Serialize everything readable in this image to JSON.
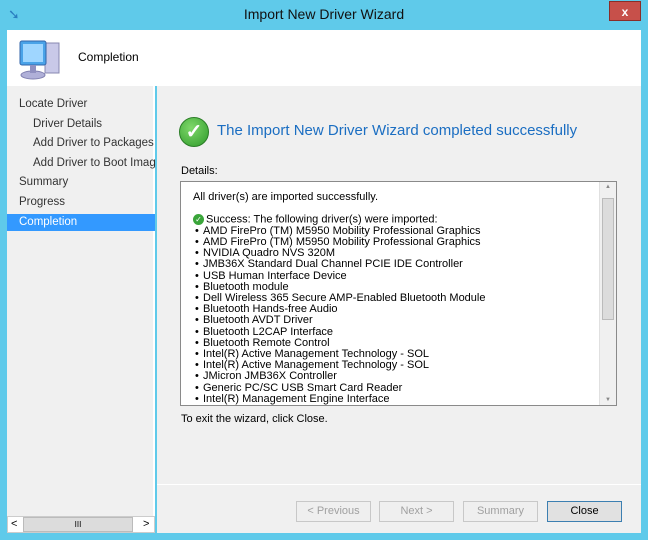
{
  "window": {
    "title": "Import New Driver Wizard",
    "close": "x"
  },
  "header": {
    "title": "Completion"
  },
  "nav": {
    "items": [
      {
        "label": "Locate Driver",
        "sub": false,
        "selected": false
      },
      {
        "label": "Driver Details",
        "sub": true,
        "selected": false
      },
      {
        "label": "Add Driver to Packages",
        "sub": true,
        "selected": false
      },
      {
        "label": "Add Driver to Boot Images",
        "sub": true,
        "selected": false
      },
      {
        "label": "Summary",
        "sub": false,
        "selected": false
      },
      {
        "label": "Progress",
        "sub": false,
        "selected": false
      },
      {
        "label": "Completion",
        "sub": false,
        "selected": true
      }
    ],
    "scroll_left": "<",
    "scroll_thumb": "III",
    "scroll_right": ">"
  },
  "main": {
    "title": "The Import New Driver Wizard completed successfully",
    "details_label": "Details:",
    "summary_line": "All driver(s) are imported successfully.",
    "success_line": "Success: The following driver(s) were imported:",
    "drivers": [
      "AMD FirePro (TM) M5950 Mobility Professional Graphics",
      "AMD FirePro (TM) M5950 Mobility Professional Graphics",
      "NVIDIA Quadro NVS 320M",
      "JMB36X Standard Dual Channel PCIE IDE Controller",
      "USB Human Interface Device",
      "Bluetooth module",
      "Dell Wireless 365 Secure AMP-Enabled Bluetooth Module",
      "Bluetooth Hands-free Audio",
      "Bluetooth AVDT Driver",
      "Bluetooth L2CAP Interface",
      "Bluetooth Remote Control",
      "Intel(R) Active Management Technology - SOL",
      "Intel(R) Active Management Technology - SOL",
      "JMicron JMB36X Controller",
      "Generic PC/SC USB Smart Card Reader",
      "Intel(R) Management Engine Interface"
    ],
    "exit_text": "To exit the wizard, click Close."
  },
  "buttons": {
    "previous": "< Previous",
    "next": "Next >",
    "summary": "Summary",
    "close": "Close"
  }
}
